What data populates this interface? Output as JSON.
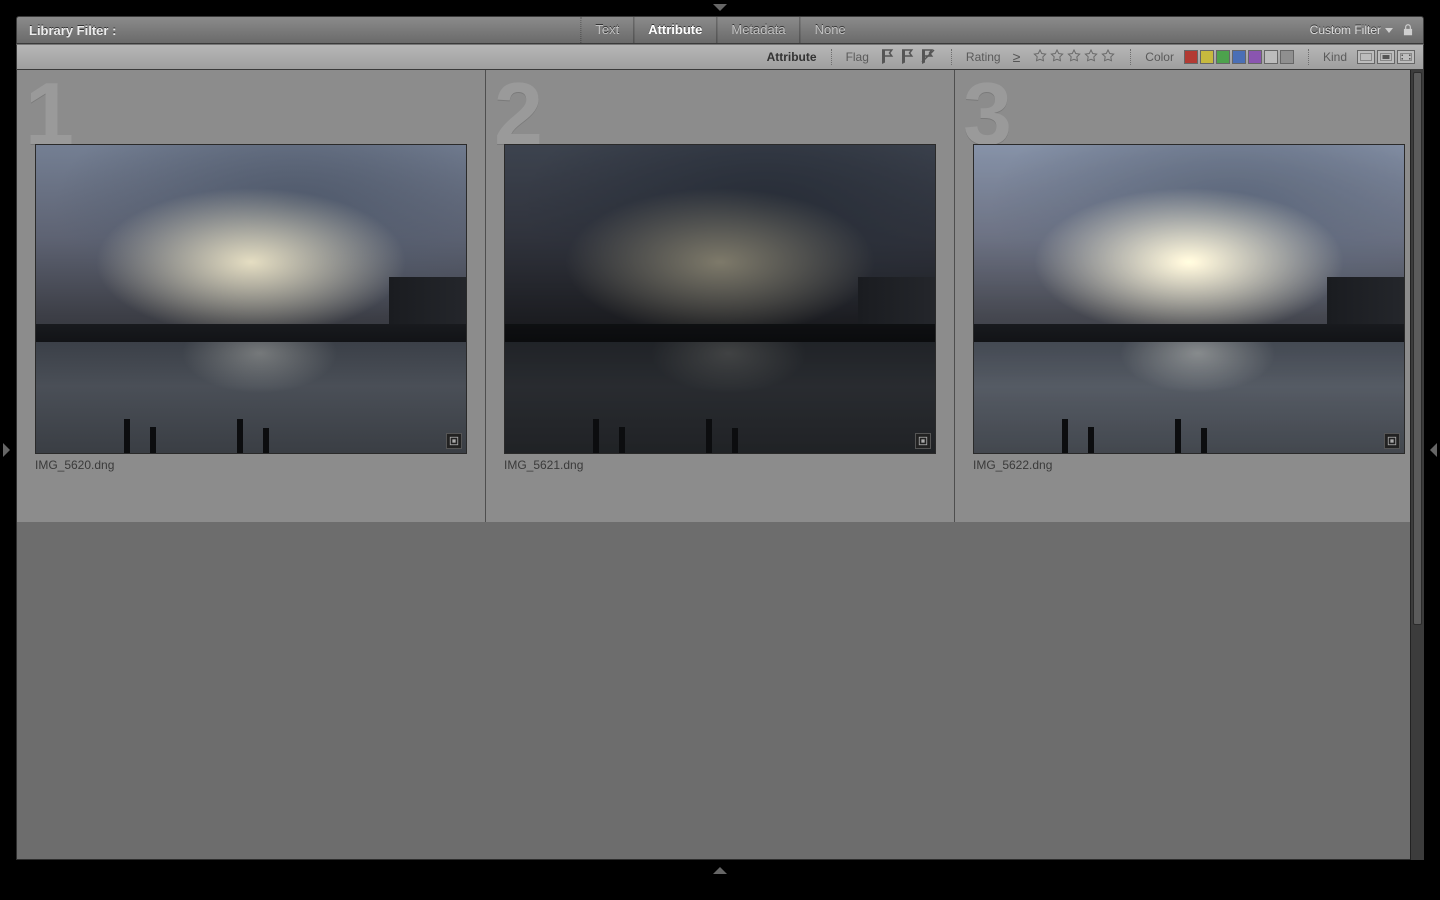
{
  "filter": {
    "title": "Library Filter :",
    "tabs": [
      "Text",
      "Attribute",
      "Metadata",
      "None"
    ],
    "active_tab": "Attribute",
    "preset": "Custom Filter"
  },
  "attr": {
    "section_label": "Attribute",
    "flag_label": "Flag",
    "rating_label": "Rating",
    "rating_op": "≥",
    "color_label": "Color",
    "kind_label": "Kind",
    "colors": [
      "#b23a33",
      "#c7b93e",
      "#4da24d",
      "#4a6fb5",
      "#8a55b0",
      "#bcbcbc",
      "#8f8f8f"
    ]
  },
  "grid": {
    "cells": [
      {
        "index": "1",
        "filename": "IMG_5620.dng",
        "variant": ""
      },
      {
        "index": "2",
        "filename": "IMG_5621.dng",
        "variant": "dark"
      },
      {
        "index": "3",
        "filename": "IMG_5622.dng",
        "variant": "bright"
      }
    ]
  }
}
